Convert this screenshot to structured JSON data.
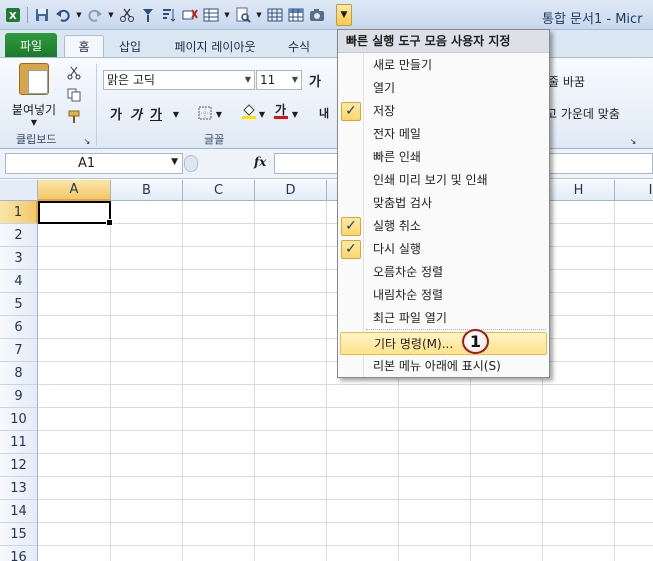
{
  "window": {
    "title": "통합 문서1 - Micr"
  },
  "qat": {
    "icons": [
      "excel-logo-icon",
      "save-icon",
      "undo-icon",
      "redo-icon",
      "cut-icon",
      "format-painter-icon",
      "sort-icon",
      "delete-icon",
      "table-icon",
      "print-preview-icon",
      "grid-icon",
      "camera-icon",
      "customize-arrow-icon"
    ]
  },
  "tabs": [
    {
      "label": "파일"
    },
    {
      "label": "홈"
    },
    {
      "label": "삽입"
    },
    {
      "label": "페이지 레이아웃"
    },
    {
      "label": "수식"
    }
  ],
  "ribbon": {
    "paste_label": "붙여넣기",
    "clipboard_label": "클립보드",
    "font_label": "글꼴",
    "font_name": "맑은 고딕",
    "font_size": "11",
    "grow_font": "가",
    "bold": "가",
    "italic": "가",
    "underline": "가",
    "wrap_text": "줄 바꿈",
    "merge_center": "고 가운데 맞춤",
    "partial_left": "내"
  },
  "formula_bar": {
    "name_box": "A1",
    "fx_label": "fx"
  },
  "grid": {
    "columns": [
      "A",
      "B",
      "C",
      "D",
      "E",
      "F",
      "G",
      "H",
      "I"
    ],
    "rows": [
      "1",
      "2",
      "3",
      "4",
      "5",
      "6",
      "7",
      "8",
      "9",
      "10",
      "11",
      "12",
      "13",
      "14",
      "15",
      "16"
    ],
    "selected_cell": "A1"
  },
  "menu": {
    "header": "빠른 실행 도구 모음 사용자 지정",
    "items": [
      {
        "label": "새로 만들기",
        "checked": false
      },
      {
        "label": "열기",
        "checked": false
      },
      {
        "label": "저장",
        "checked": true
      },
      {
        "label": "전자 메일",
        "checked": false
      },
      {
        "label": "빠른 인쇄",
        "checked": false
      },
      {
        "label": "인쇄 미리 보기 및 인쇄",
        "checked": false
      },
      {
        "label": "맞춤법 검사",
        "checked": false
      },
      {
        "label": "실행 취소",
        "checked": true
      },
      {
        "label": "다시 실행",
        "checked": true
      },
      {
        "label": "오름차순 정렬",
        "checked": false
      },
      {
        "label": "내림차순 정렬",
        "checked": false
      },
      {
        "label": "최근 파일 열기",
        "checked": false
      }
    ],
    "more_commands": "기타 명령(M)...",
    "show_below_ribbon": "리본 메뉴 아래에 표시(S)",
    "check_glyph": "✓"
  },
  "callout": {
    "number": "1"
  }
}
